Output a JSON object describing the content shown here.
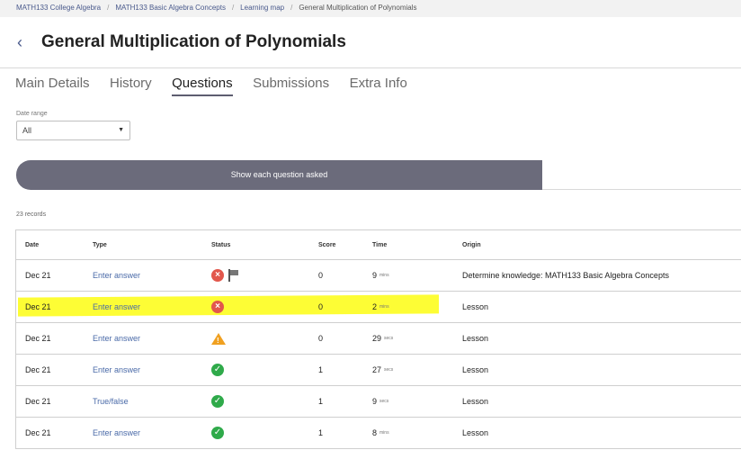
{
  "breadcrumb": {
    "items": [
      "MATH133 College Algebra",
      "MATH133 Basic Algebra Concepts",
      "Learning map"
    ],
    "current": "General Multiplication of Polynomials"
  },
  "header": {
    "back_icon": "chevron-left-icon",
    "title": "General Multiplication of Polynomials"
  },
  "tabs": [
    "Main Details",
    "History",
    "Questions",
    "Submissions",
    "Extra Info"
  ],
  "active_tab": "Questions",
  "filter": {
    "label": "Date range",
    "value": "All"
  },
  "toggle_button": "Show each question asked",
  "records_label": "23 records",
  "table": {
    "columns": [
      "Date",
      "Type",
      "Status",
      "Score",
      "Time",
      "Origin"
    ],
    "rows": [
      {
        "date": "Dec 21",
        "type": "Enter answer",
        "status": "incorrect",
        "flagged": true,
        "score": "0",
        "time": "9",
        "unit": "mins",
        "origin": "Determine knowledge: MATH133 Basic Algebra Concepts"
      },
      {
        "date": "Dec 21",
        "type": "Enter answer",
        "status": "incorrect",
        "flagged": false,
        "score": "0",
        "time": "2",
        "unit": "mins",
        "origin": "Lesson"
      },
      {
        "date": "Dec 21",
        "type": "Enter answer",
        "status": "warning",
        "flagged": false,
        "score": "0",
        "time": "29",
        "unit": "secs",
        "origin": "Lesson"
      },
      {
        "date": "Dec 21",
        "type": "Enter answer",
        "status": "correct",
        "flagged": false,
        "score": "1",
        "time": "27",
        "unit": "secs",
        "origin": "Lesson"
      },
      {
        "date": "Dec 21",
        "type": "True/false",
        "status": "correct",
        "flagged": false,
        "score": "1",
        "time": "9",
        "unit": "secs",
        "origin": "Lesson"
      },
      {
        "date": "Dec 21",
        "type": "Enter answer",
        "status": "correct",
        "flagged": false,
        "score": "1",
        "time": "8",
        "unit": "mins",
        "origin": "Lesson"
      }
    ]
  },
  "colors": {
    "accent": "#6b6b7b",
    "link": "#4a6aa8",
    "incorrect": "#e2574c",
    "correct": "#2faa4a",
    "warning": "#f0a020",
    "highlight": "#fdfd2a"
  }
}
